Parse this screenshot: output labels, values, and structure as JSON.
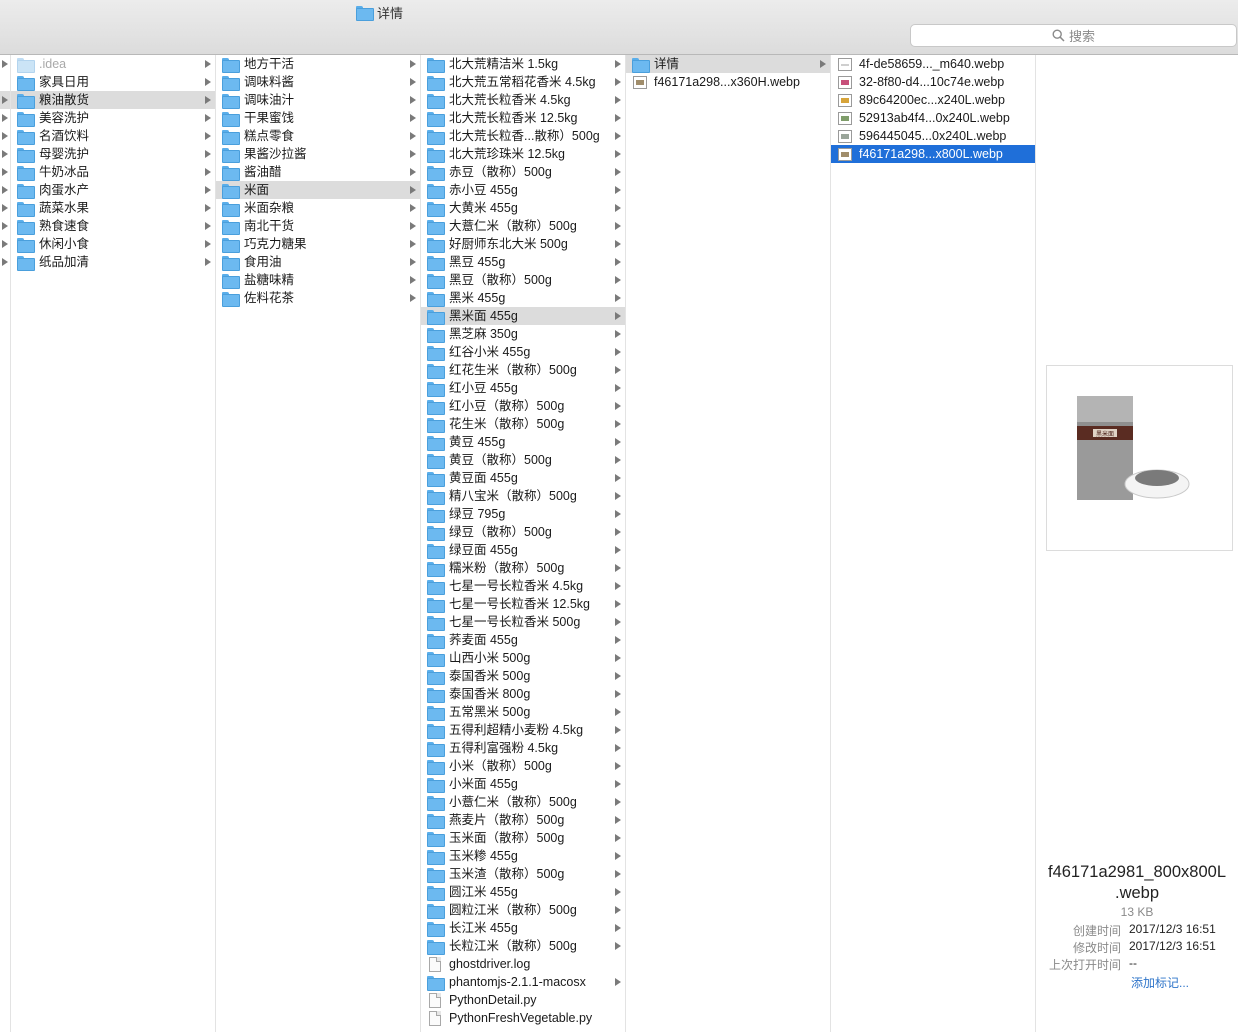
{
  "window": {
    "title": "详情"
  },
  "search": {
    "placeholder": "搜索"
  },
  "col1": [
    {
      "label": ".idea",
      "faded": true,
      "arrow": true
    },
    {
      "label": "家具日用",
      "arrow": true
    },
    {
      "label": "粮油散货",
      "arrow": true,
      "selected": true
    },
    {
      "label": "美容洗护",
      "arrow": true
    },
    {
      "label": "名酒饮料",
      "arrow": true
    },
    {
      "label": "母婴洗护",
      "arrow": true
    },
    {
      "label": "牛奶冰品",
      "arrow": true
    },
    {
      "label": "肉蛋水产",
      "arrow": true
    },
    {
      "label": "蔬菜水果",
      "arrow": true
    },
    {
      "label": "熟食速食",
      "arrow": true
    },
    {
      "label": "休闲小食",
      "arrow": true
    },
    {
      "label": "纸品加清",
      "arrow": true
    }
  ],
  "col2": [
    {
      "label": "地方干活",
      "arrow": true
    },
    {
      "label": "调味料酱",
      "arrow": true
    },
    {
      "label": "调味油汁",
      "arrow": true
    },
    {
      "label": "干果蜜饯",
      "arrow": true
    },
    {
      "label": "糕点零食",
      "arrow": true
    },
    {
      "label": "果酱沙拉酱",
      "arrow": true
    },
    {
      "label": "酱油醋",
      "arrow": true
    },
    {
      "label": "米面",
      "arrow": true,
      "selected": true
    },
    {
      "label": "米面杂粮",
      "arrow": true
    },
    {
      "label": "南北干货",
      "arrow": true
    },
    {
      "label": "巧克力糖果",
      "arrow": true
    },
    {
      "label": "食用油",
      "arrow": true
    },
    {
      "label": "盐糖味精",
      "arrow": true
    },
    {
      "label": "佐料花茶",
      "arrow": true
    }
  ],
  "col3": [
    {
      "label": "北大荒精洁米 1.5kg",
      "arrow": true
    },
    {
      "label": "北大荒五常稻花香米 4.5kg",
      "arrow": true
    },
    {
      "label": "北大荒长粒香米 4.5kg",
      "arrow": true
    },
    {
      "label": "北大荒长粒香米 12.5kg",
      "arrow": true
    },
    {
      "label": "北大荒长粒香...散称）500g",
      "arrow": true
    },
    {
      "label": "北大荒珍珠米 12.5kg",
      "arrow": true
    },
    {
      "label": "赤豆（散称）500g",
      "arrow": true
    },
    {
      "label": "赤小豆 455g",
      "arrow": true
    },
    {
      "label": "大黄米 455g",
      "arrow": true
    },
    {
      "label": "大薏仁米（散称）500g",
      "arrow": true
    },
    {
      "label": "好厨师东北大米 500g",
      "arrow": true
    },
    {
      "label": "黑豆 455g",
      "arrow": true
    },
    {
      "label": "黑豆（散称）500g",
      "arrow": true
    },
    {
      "label": "黑米 455g",
      "arrow": true
    },
    {
      "label": "黑米面 455g",
      "arrow": true,
      "selected": true
    },
    {
      "label": "黑芝麻 350g",
      "arrow": true
    },
    {
      "label": "红谷小米 455g",
      "arrow": true
    },
    {
      "label": "红花生米（散称）500g",
      "arrow": true
    },
    {
      "label": "红小豆 455g",
      "arrow": true
    },
    {
      "label": "红小豆（散称）500g",
      "arrow": true
    },
    {
      "label": "花生米（散称）500g",
      "arrow": true
    },
    {
      "label": "黄豆 455g",
      "arrow": true
    },
    {
      "label": "黄豆（散称）500g",
      "arrow": true
    },
    {
      "label": "黄豆面 455g",
      "arrow": true
    },
    {
      "label": "精八宝米（散称）500g",
      "arrow": true
    },
    {
      "label": "绿豆 795g",
      "arrow": true
    },
    {
      "label": "绿豆（散称）500g",
      "arrow": true
    },
    {
      "label": "绿豆面 455g",
      "arrow": true
    },
    {
      "label": "糯米粉（散称）500g",
      "arrow": true
    },
    {
      "label": "七星一号长粒香米 4.5kg",
      "arrow": true
    },
    {
      "label": "七星一号长粒香米 12.5kg",
      "arrow": true
    },
    {
      "label": "七星一号长粒香米 500g",
      "arrow": true
    },
    {
      "label": "荞麦面 455g",
      "arrow": true
    },
    {
      "label": "山西小米 500g",
      "arrow": true
    },
    {
      "label": "泰国香米 500g",
      "arrow": true
    },
    {
      "label": "泰国香米 800g",
      "arrow": true
    },
    {
      "label": "五常黑米 500g",
      "arrow": true
    },
    {
      "label": "五得利超精小麦粉 4.5kg",
      "arrow": true
    },
    {
      "label": "五得利富强粉 4.5kg",
      "arrow": true
    },
    {
      "label": "小米（散称）500g",
      "arrow": true
    },
    {
      "label": "小米面 455g",
      "arrow": true
    },
    {
      "label": "小薏仁米（散称）500g",
      "arrow": true
    },
    {
      "label": "燕麦片（散称）500g",
      "arrow": true
    },
    {
      "label": "玉米面（散称）500g",
      "arrow": true
    },
    {
      "label": "玉米糁 455g",
      "arrow": true
    },
    {
      "label": "玉米渣（散称）500g",
      "arrow": true
    },
    {
      "label": "圆江米 455g",
      "arrow": true
    },
    {
      "label": "圆粒江米（散称）500g",
      "arrow": true
    },
    {
      "label": "长江米 455g",
      "arrow": true
    },
    {
      "label": "长粒江米（散称）500g",
      "arrow": true
    },
    {
      "label": "ghostdriver.log",
      "arrow": false,
      "icon": "document-icon"
    },
    {
      "label": "phantomjs-2.1.1-macosx",
      "arrow": true
    },
    {
      "label": "PythonDetail.py",
      "arrow": false,
      "icon": "python-file-icon"
    },
    {
      "label": "PythonFreshVegetable.py",
      "arrow": false,
      "icon": "python-file-icon"
    }
  ],
  "col4": [
    {
      "label": "详情",
      "arrow": true,
      "selected": true
    },
    {
      "label": "f46171a298...x360H.webp",
      "arrow": false,
      "icon": "image-file-icon"
    }
  ],
  "col5": [
    {
      "label": "4f-de58659..._m640.webp",
      "tint": "c0"
    },
    {
      "label": "32-8f80-d4...10c74e.webp",
      "tint": "c2"
    },
    {
      "label": "89c64200ec...x240L.webp",
      "tint": "c3"
    },
    {
      "label": "52913ab4f4...0x240L.webp",
      "tint": "c4"
    },
    {
      "label": "596445045...0x240L.webp",
      "tint": "c5"
    },
    {
      "label": "f46171a298...x800L.webp",
      "tint": "c1",
      "selectedBlue": true
    }
  ],
  "preview": {
    "filename_line1": "f46171a2981_800x800L",
    "filename_line2": ".webp",
    "size": "13 KB",
    "created_label": "创建时间",
    "created_value": "2017/12/3 16:51",
    "modified_label": "修改时间",
    "modified_value": "2017/12/3 16:51",
    "opened_label": "上次打开时间",
    "opened_value": "--",
    "add_tags": "添加标记...",
    "thumb_label": "黑米面"
  },
  "colors": {
    "selection_blue": "#1f6fd9",
    "selection_grey": "#dcdcdc",
    "link_blue": "#2e74c9"
  }
}
